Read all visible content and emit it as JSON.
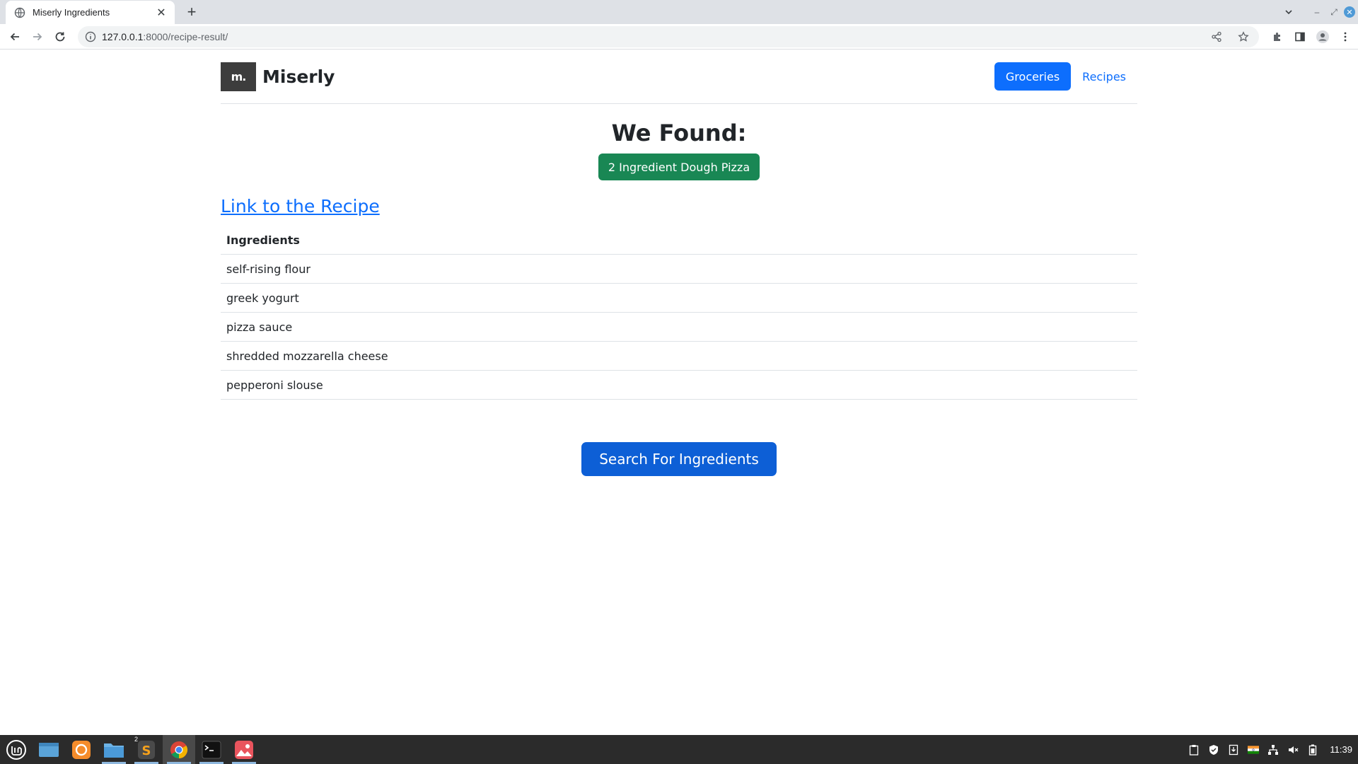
{
  "browser": {
    "tab_title": "Miserly Ingredients",
    "url_host": "127.0.0.1",
    "url_rest": ":8000/recipe-result/"
  },
  "site": {
    "logo_text": "m.",
    "brand": "Miserly",
    "nav": {
      "groceries": "Groceries",
      "recipes": "Recipes"
    }
  },
  "result": {
    "heading": "We Found:",
    "recipe_name": "2 Ingredient Dough Pizza",
    "link_text": "Link to the Recipe",
    "table_header": "Ingredients",
    "ingredients": [
      "self-rising flour",
      "greek yogurt",
      "pizza sauce",
      "shredded mozzarella cheese",
      "pepperoni slouse"
    ],
    "search_button": "Search For Ingredients"
  },
  "taskbar": {
    "sublime_count": "2",
    "clock": "11:39"
  },
  "colors": {
    "primary": "#0d6efd",
    "success": "#198754",
    "taskbar": "#2b2b2b"
  }
}
